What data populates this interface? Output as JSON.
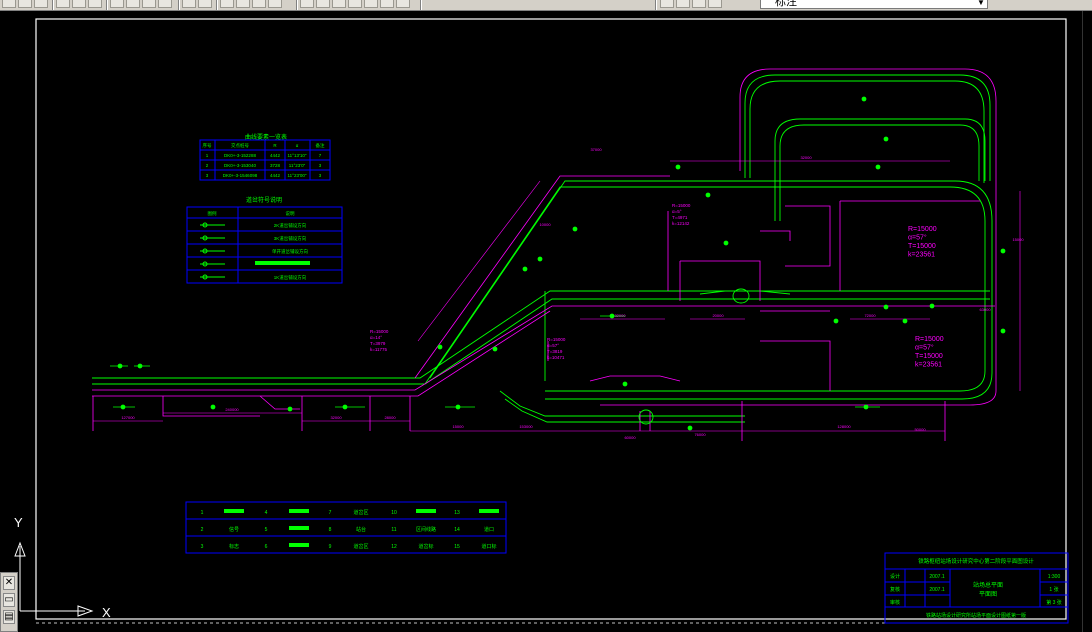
{
  "toolbar": {
    "buttons": [
      "new-icon",
      "open-icon",
      "save-icon",
      "print-icon",
      "preview-icon",
      "publish-icon",
      "cut-icon",
      "copy-icon",
      "paste-icon",
      "matchprop-icon",
      "undo-icon",
      "redo-icon",
      "pan-icon",
      "zoom-realtime-icon",
      "zoom-window-icon",
      "zoom-previous-icon",
      "properties-icon",
      "design-center-icon",
      "tool-palette-icon",
      "sheetset-icon",
      "markup-icon",
      "calculator-icon",
      "help-icon",
      "layer-manager-icon",
      "layer-state-icon",
      "layer-prev-icon",
      "match-layer-icon"
    ],
    "layer_dropdown": {
      "value": "标注"
    }
  },
  "drawing": {
    "colors": {
      "background": "#000000",
      "frame": "#ffffff",
      "road": "#00ff00",
      "boundary": "#ff00ff",
      "table": "#0000ff",
      "text": "#00ff00",
      "annotation": "#ff00ff"
    },
    "curve_table": {
      "title": "曲线要素一览表",
      "headers": [
        "序号",
        "交点桩号",
        "R",
        "α",
        "备注"
      ],
      "rows": [
        [
          "1",
          "DK0+-3-152288",
          "4442",
          "11°13'10\"",
          "7"
        ],
        [
          "2",
          "DK0+-3-153040",
          "3728",
          "11°23'0\"",
          "3"
        ],
        [
          "3",
          "DK0+-3-1546098",
          "4442",
          "11°23'00\"",
          "3"
        ]
      ]
    },
    "legend_table": {
      "title": "道岔符号说明",
      "headers": [
        "图例",
        "说明"
      ],
      "rows": [
        "2K道岔铺设方向",
        "3K道岔铺设方向",
        "单开道岔铺设方向",
        "",
        "1K道岔铺设方向"
      ]
    },
    "curve_labels": [
      [
        "R=15000",
        "α=5°",
        "T=4971",
        "k=12142"
      ],
      [
        "R=15000",
        "α=57°",
        "T=15000",
        "k=23561"
      ],
      [
        "R=15000",
        "α=14°",
        "T=3979",
        "k=11775"
      ],
      [
        "R=15000",
        "α=57°",
        "T=3819",
        "k=10471"
      ],
      [
        "R=15000",
        "α=57°",
        "T=15000",
        "k=23561"
      ]
    ],
    "dimensions": [
      "127000",
      "240000",
      "32000",
      "28000",
      "153000",
      "15000",
      "128000",
      "32000",
      "20000",
      "72000",
      "32000",
      "15000",
      "10000",
      "37000",
      "76000",
      "63000",
      "50000",
      "60000"
    ],
    "bottom_table": {
      "rows": [
        [
          "1",
          "",
          "4",
          "",
          "7",
          "道岔区",
          "10",
          "",
          "13",
          ""
        ],
        [
          "2",
          "信号",
          "5",
          "",
          "8",
          "站台",
          "11",
          "区间线路",
          "14",
          "道口"
        ],
        [
          "3",
          "标志",
          "6",
          "",
          "9",
          "道岔区",
          "12",
          "道岔标",
          "15",
          "道口标"
        ]
      ]
    },
    "title_block": {
      "project": "铁路枢纽站场设计研究中心第二阶段平面图设计",
      "drawing_name": "站场总平面",
      "sub_name": "平面图",
      "scale": "1:300",
      "sheet": "1 张",
      "sheet_no": "第 3 张",
      "designer": "设计",
      "checker": "复核",
      "approver": "审核",
      "date1": "2007.1",
      "date2": "2007.1",
      "footer": "铁路站场设计研究所站场平面设计图纸第一版"
    },
    "ucs": {
      "x_label": "X",
      "y_label": "Y"
    }
  }
}
